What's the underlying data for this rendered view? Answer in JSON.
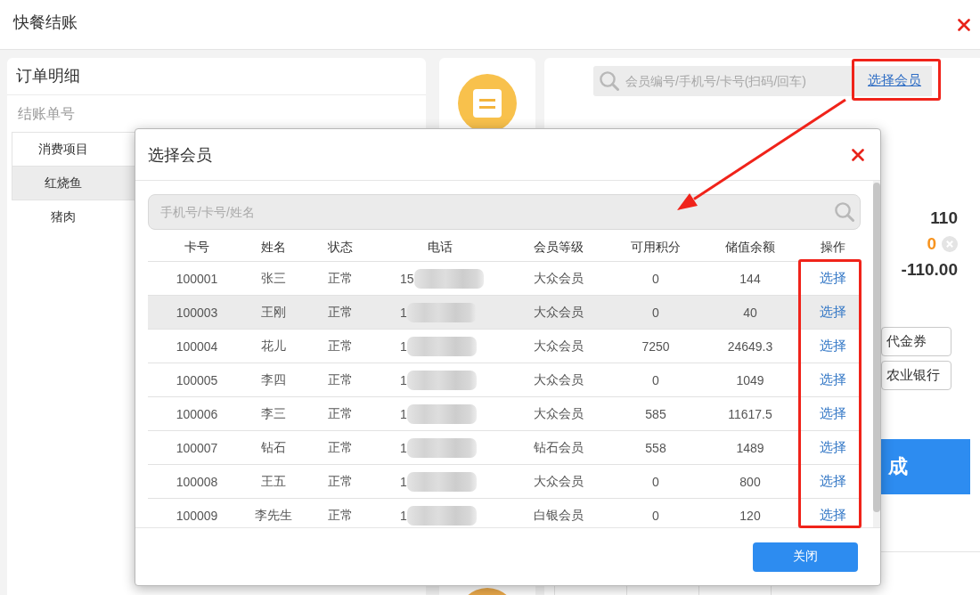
{
  "window": {
    "title": "快餐结账"
  },
  "order_panel": {
    "title": "订单明细",
    "order_number_label": "结账单号",
    "columns": [
      "消费项目"
    ],
    "rows": [
      {
        "item": "红烧鱼",
        "highlighted": true
      },
      {
        "item": "猪肉",
        "highlighted": false
      }
    ]
  },
  "payment_panel": {
    "member_search": {
      "placeholder": "会员编号/手机号/卡号(扫码/回车)",
      "link": "选择会员"
    },
    "amounts": [
      {
        "kind": "plain",
        "value": "110"
      },
      {
        "kind": "clearable",
        "value": "0"
      },
      {
        "kind": "plain",
        "value": "-110.00"
      }
    ],
    "payment_methods": [
      "代金券",
      "农业银行"
    ],
    "finish_button": "成"
  },
  "dialog": {
    "title": "选择会员",
    "search": {
      "placeholder": "手机号/卡号/姓名"
    },
    "columns": [
      "卡号",
      "姓名",
      "状态",
      "电话",
      "会员等级",
      "可用积分",
      "储值余额",
      "操作"
    ],
    "rows": [
      {
        "card": "100001",
        "name": "张三",
        "status": "正常",
        "phone": "15",
        "phone_redacted": true,
        "grade": "大众会员",
        "points": "0",
        "balance": "144",
        "action": "选择",
        "highlighted": false
      },
      {
        "card": "100003",
        "name": "王刚",
        "status": "正常",
        "phone": "1",
        "phone_redacted": true,
        "grade": "大众会员",
        "points": "0",
        "balance": "40",
        "action": "选择",
        "highlighted": true
      },
      {
        "card": "100004",
        "name": "花儿",
        "status": "正常",
        "phone": "1",
        "phone_redacted": true,
        "grade": "大众会员",
        "points": "7250",
        "balance": "24649.3",
        "action": "选择",
        "highlighted": false
      },
      {
        "card": "100005",
        "name": "李四",
        "status": "正常",
        "phone": "1",
        "phone_redacted": true,
        "grade": "大众会员",
        "points": "0",
        "balance": "1049",
        "action": "选择",
        "highlighted": false
      },
      {
        "card": "100006",
        "name": "李三",
        "status": "正常",
        "phone": "1",
        "phone_redacted": true,
        "grade": "大众会员",
        "points": "585",
        "balance": "11617.5",
        "action": "选择",
        "highlighted": false
      },
      {
        "card": "100007",
        "name": "钻石",
        "status": "正常",
        "phone": "1",
        "phone_redacted": true,
        "grade": "钻石会员",
        "points": "558",
        "balance": "1489",
        "action": "选择",
        "highlighted": false
      },
      {
        "card": "100008",
        "name": "王五",
        "status": "正常",
        "phone": "1",
        "phone_redacted": true,
        "grade": "大众会员",
        "points": "0",
        "balance": "800",
        "action": "选择",
        "highlighted": false
      },
      {
        "card": "100009",
        "name": "李先生",
        "status": "正常",
        "phone": "1",
        "phone_redacted": true,
        "grade": "白银会员",
        "points": "0",
        "balance": "120",
        "action": "选择",
        "highlighted": false
      }
    ],
    "close_button": "关闭"
  }
}
